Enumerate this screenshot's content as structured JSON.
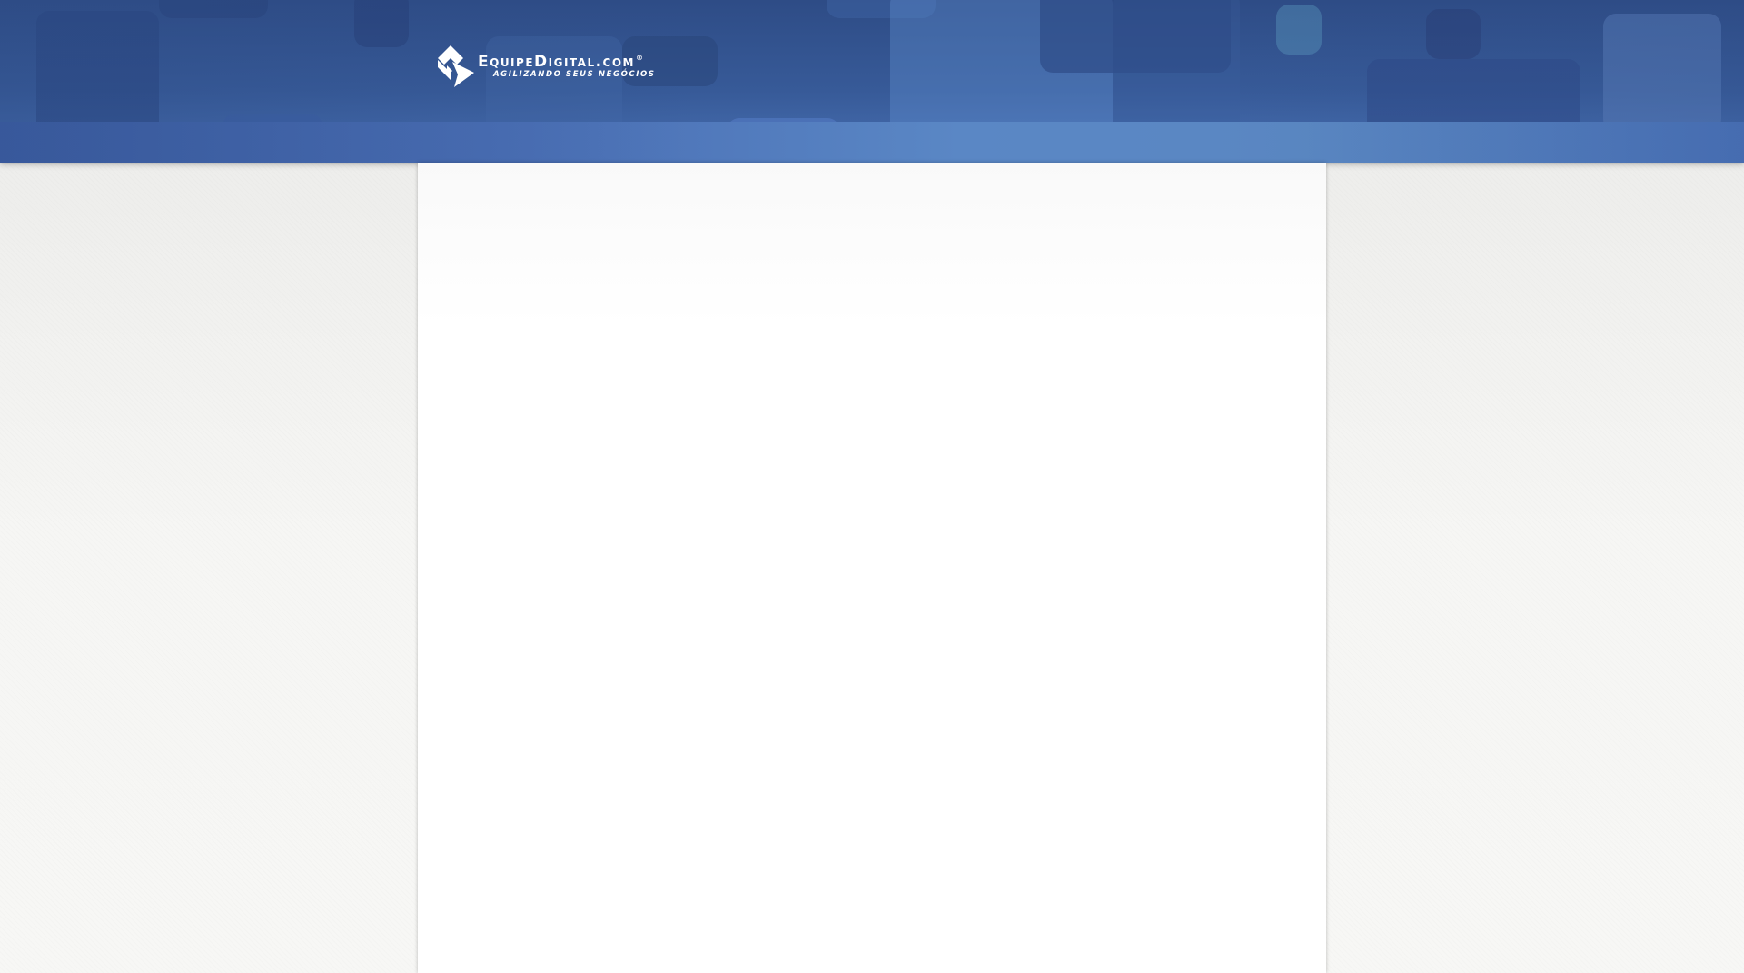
{
  "header": {
    "logo": {
      "name": "EquipeDigital.com",
      "registered_mark": "®",
      "tagline": "Agilizando seus negócios",
      "icon": "equipedigital-logo-icon"
    }
  },
  "main": {
    "content": ""
  },
  "colors": {
    "header_dark": "#2e4c86",
    "header_band": "#5a87c5",
    "page_background": "#f2f2f0",
    "content_background": "#ffffff"
  }
}
